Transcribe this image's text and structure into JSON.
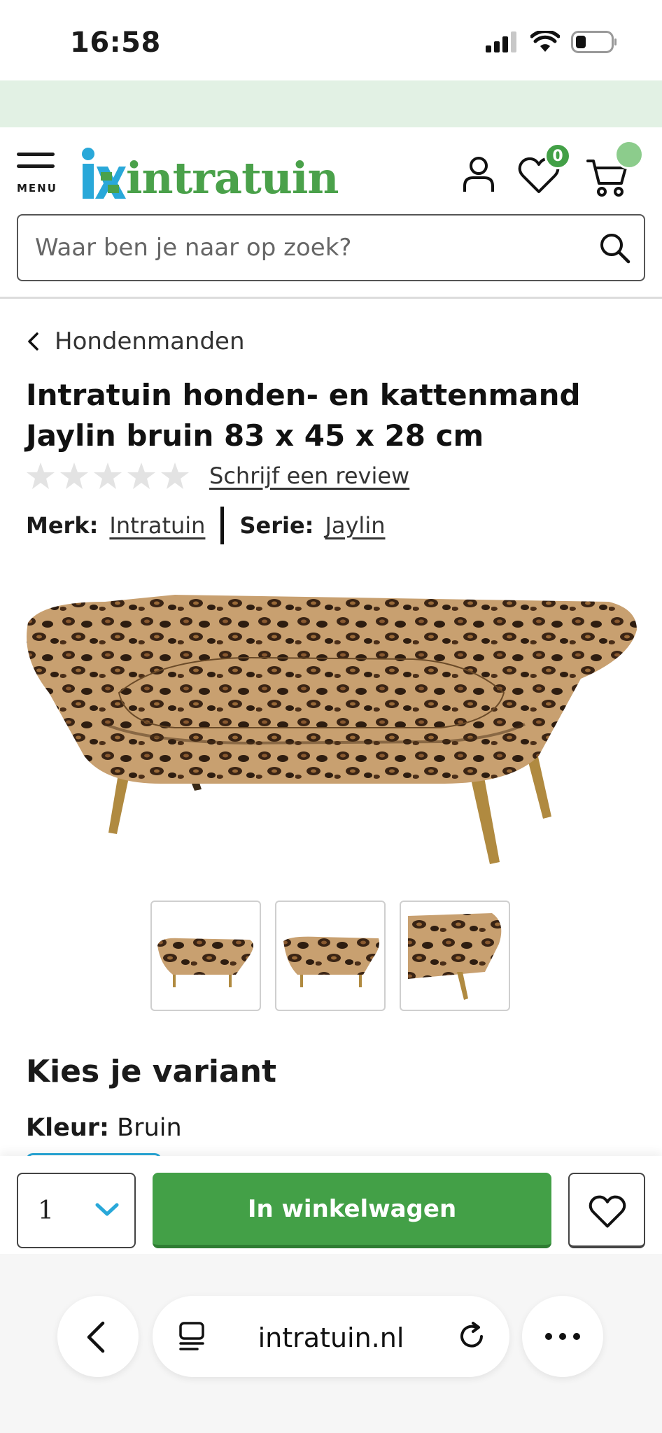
{
  "status_bar": {
    "time": "16:58"
  },
  "header": {
    "menu_label": "MENU",
    "logo_text": "intratuin",
    "wishlist_count": "0"
  },
  "search": {
    "placeholder": "Waar ben je naar op zoek?"
  },
  "breadcrumb": {
    "label": "Hondenmanden"
  },
  "product": {
    "title": "Intratuin honden- en kattenmand Jaylin bruin 83 x 45 x 28 cm",
    "rating_stars": 0,
    "review_link": "Schrijf een review",
    "brand_label": "Merk:",
    "brand_value": "Intratuin",
    "series_label": "Serie:",
    "series_value": "Jaylin"
  },
  "variant": {
    "title": "Kies je variant",
    "color_label": "Kleur:",
    "color_value": "Bruin"
  },
  "actions": {
    "quantity": "1",
    "add_to_cart": "In winkelwagen"
  },
  "browser": {
    "url": "intratuin.nl"
  },
  "colors": {
    "brand_green": "#43a047",
    "logo_blue": "#29a8d9",
    "promo_strip": "#e2f1e4"
  }
}
